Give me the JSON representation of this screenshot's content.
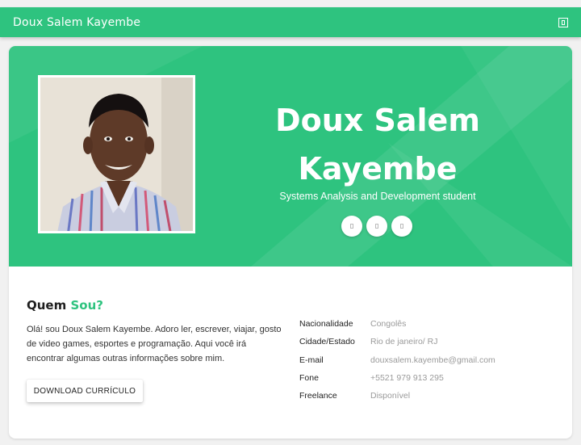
{
  "header": {
    "title": "Doux Salem Kayembe",
    "menu_icon": "menu-icon"
  },
  "hero": {
    "name_line1": "Doux Salem",
    "name_line2": "Kayembe",
    "subtitle": "Systems Analysis and Development student",
    "photo_alt": "Doux Salem Kayembe",
    "social_icons": [
      "social-icon-1",
      "social-icon-2",
      "social-icon-3"
    ]
  },
  "about": {
    "title_plain": "Quem ",
    "title_accent": "Sou?",
    "text": "Olá! sou Doux Salem Kayembe. Adoro ler, escrever, viajar, gosto de video games, esportes e programação. Aqui você irá encontrar algumas outras informações sobre mim.",
    "download_label": "DOWNLOAD CURRÍCULO"
  },
  "info": [
    {
      "key": "Nacionalidade",
      "value": "Congolês"
    },
    {
      "key": "Cidade/Estado",
      "value": "Rio de janeiro/ RJ"
    },
    {
      "key": "E-mail",
      "value": "douxsalem.kayembe@gmail.com"
    },
    {
      "key": "Fone",
      "value": "+5521 979 913 295"
    },
    {
      "key": "Freelance",
      "value": "Disponível"
    }
  ],
  "colors": {
    "accent": "#2ec37f",
    "background": "#f1f1f1"
  }
}
